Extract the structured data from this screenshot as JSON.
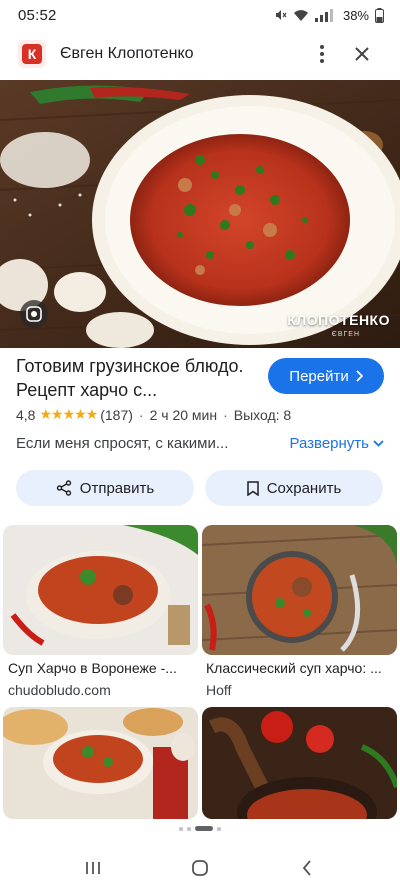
{
  "status_bar": {
    "time": "05:52",
    "battery": "38%"
  },
  "header": {
    "site_name": "Євген Клопотенко",
    "logo_letter": "К"
  },
  "hero": {
    "watermark": "КЛОПОТЕНКО",
    "watermark_sub": "ЄВГЕН"
  },
  "result": {
    "title": "Готовим грузинское блюдо. Рецепт харчо с...",
    "go_label": "Перейти",
    "rating": "4,8",
    "stars": "★★★★★",
    "reviews": "(187)",
    "time": "2 ч 20 мин",
    "yield": "Выход: 8",
    "description": "Если меня спросят, с какими...",
    "expand_label": "Развернуть"
  },
  "actions": {
    "share_label": "Отправить",
    "save_label": "Сохранить"
  },
  "related": [
    {
      "title": "Суп Харчо в Воронеже -...",
      "source": "chudobludo.com"
    },
    {
      "title": "Классический суп харчо: ...",
      "source": "Hoff"
    }
  ],
  "colors": {
    "accent": "#1a73e8",
    "chip_bg": "#e8f0fe",
    "star": "#f4a915"
  },
  "icons": [
    "wifi-icon",
    "signal-icon",
    "battery-icon",
    "more-vert-icon",
    "close-icon",
    "lens-icon",
    "chevron-right-icon",
    "chevron-down-icon",
    "share-icon",
    "bookmark-icon",
    "recents-icon",
    "home-icon",
    "back-icon"
  ]
}
